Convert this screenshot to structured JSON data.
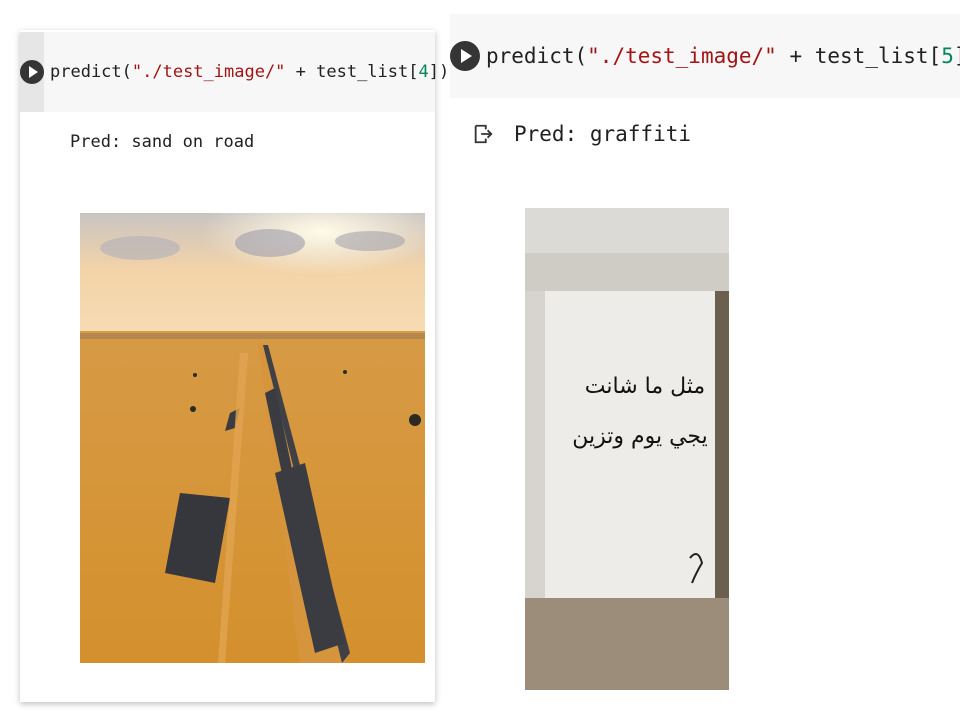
{
  "left_cell": {
    "code": {
      "func": "predict(",
      "path": "\"./test_image/\"",
      "plus": " + test_list[",
      "index": "4",
      "close": "])"
    },
    "output_text": "Pred: sand on road",
    "image_alt": "desert road covered by sand"
  },
  "right_cell": {
    "code": {
      "func": "predict(",
      "path": "\"./test_image/\"",
      "plus": " + test_list[",
      "index": "5",
      "close": "])"
    },
    "output_text": "Pred: graffiti",
    "graffiti_text_line1": "مثل ما شانت",
    "graffiti_text_line2": "يجي يوم وتزين",
    "image_alt": "concrete bridge pillar with Arabic graffiti"
  },
  "colors": {
    "code_bg": "#f7f7f7",
    "gutter_bg": "#e6e6e6",
    "run_button": "#353535",
    "string": "#a31515",
    "number": "#098658"
  },
  "icons": {
    "run": "play-circle-icon",
    "output": "output-arrow-icon"
  }
}
